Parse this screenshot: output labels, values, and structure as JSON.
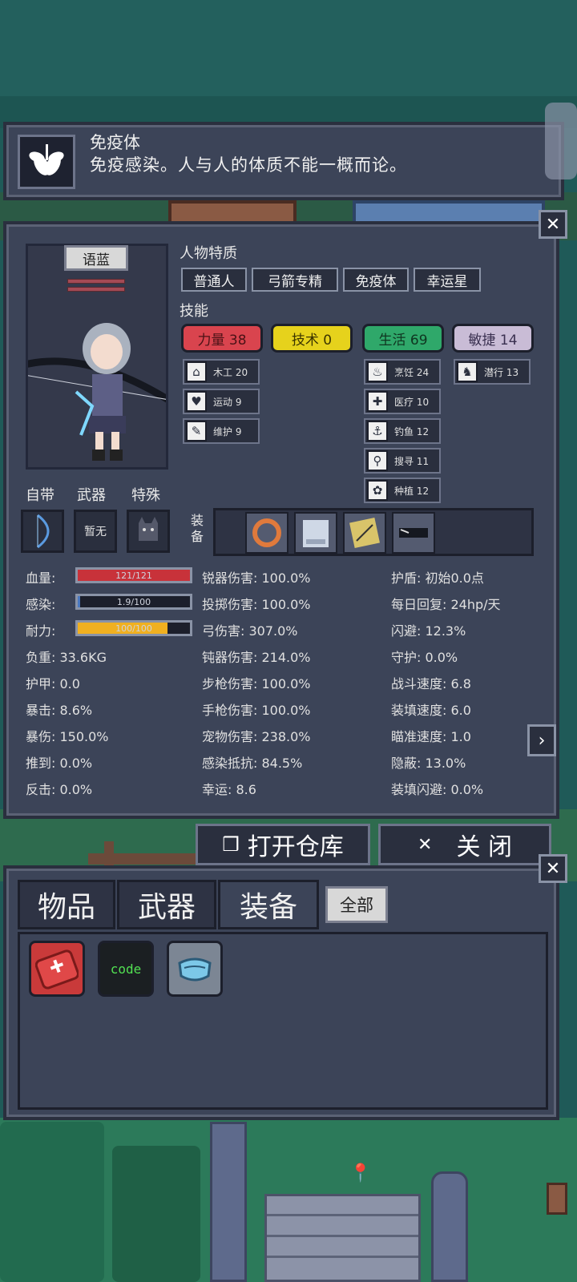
{
  "tooltip": {
    "title": "免疫体",
    "description": "免疫感染。人与人的体质不能一概而论。"
  },
  "character": {
    "name": "语蓝",
    "traits_label": "人物特质",
    "traits": [
      "普通人",
      "弓箭专精",
      "免疫体",
      "幸运星"
    ],
    "skills_label": "技能",
    "skill_groups": [
      {
        "label": "力量 38",
        "color": "#d9444e"
      },
      {
        "label": "技术 0",
        "color": "#e6d21c"
      },
      {
        "label": "生活 69",
        "color": "#2fa86a"
      },
      {
        "label": "敏捷 14",
        "color": "#c9bcd6"
      }
    ],
    "sub_skills": {
      "col1": [
        {
          "icon": "house-icon",
          "glyph": "⌂",
          "label": "木工 20"
        },
        {
          "icon": "heart-icon",
          "glyph": "♥",
          "label": "运动 9"
        },
        {
          "icon": "wrench-icon",
          "glyph": "✎",
          "label": "维护 9"
        }
      ],
      "col3": [
        {
          "icon": "pot-icon",
          "glyph": "♨",
          "label": "烹饪 24"
        },
        {
          "icon": "medkit-icon",
          "glyph": "✚",
          "label": "医疗 10"
        },
        {
          "icon": "fishing-icon",
          "glyph": "⚓",
          "label": "钓鱼 12"
        },
        {
          "icon": "magnifier-icon",
          "glyph": "⚲",
          "label": "搜寻 11"
        },
        {
          "icon": "flower-icon",
          "glyph": "✿",
          "label": "种植 12"
        }
      ],
      "col4": [
        {
          "icon": "sneak-icon",
          "glyph": "♞",
          "label": "潜行 13"
        }
      ]
    },
    "loadout_labels": {
      "builtin": "自带",
      "weapon": "武器",
      "special": "特殊",
      "equipment": "装备"
    },
    "weapon_slot_text": "暂无"
  },
  "stats": {
    "col1": {
      "hp": {
        "label": "血量:",
        "text": "121/121",
        "fill": 1.0,
        "color": "#c8323a"
      },
      "infection": {
        "label": "感染:",
        "text": "1.9/100",
        "fill": 0.019,
        "color": "#4a78c0"
      },
      "stamina": {
        "label": "耐力:",
        "text": "100/100",
        "fill": 0.8,
        "color": "#f0b020"
      },
      "rows": [
        "负重: 33.6KG",
        "护甲: 0.0",
        "暴击: 8.6%",
        "暴伤: 150.0%",
        "推到: 0.0%",
        "反击: 0.0%"
      ]
    },
    "col2": [
      "锐器伤害: 100.0%",
      "投掷伤害: 100.0%",
      "弓伤害: 307.0%",
      "钝器伤害: 214.0%",
      "步枪伤害: 100.0%",
      "手枪伤害: 100.0%",
      "宠物伤害: 238.0%",
      "感染抵抗: 84.5%",
      "幸运: 8.6"
    ],
    "col3": [
      "护盾: 初始0.0点",
      "每日回复: 24hp/天",
      "闪避: 12.3%",
      "守护: 0.0%",
      "战斗速度: 6.8",
      "装填速度: 6.0",
      "瞄准速度: 1.0",
      "隐蔽: 13.0%",
      "装填闪避: 0.0%"
    ]
  },
  "actions": {
    "open_storage": "打开仓库",
    "close": "关 闭",
    "close_glyph": "✕"
  },
  "inventory": {
    "tabs": [
      "物品",
      "武器",
      "装备"
    ],
    "filter": "全部",
    "items": [
      {
        "icon": "first-aid-kit-icon",
        "bg": "#c93a3a"
      },
      {
        "icon": "code-book-icon",
        "text": "code",
        "bg": "#1b1f22"
      },
      {
        "icon": "face-mask-icon",
        "bg": "#7c8694"
      }
    ]
  },
  "colors": {
    "panel": "#3c4458",
    "panel_border": "#2a2f3e",
    "background": "#1f5a58"
  }
}
